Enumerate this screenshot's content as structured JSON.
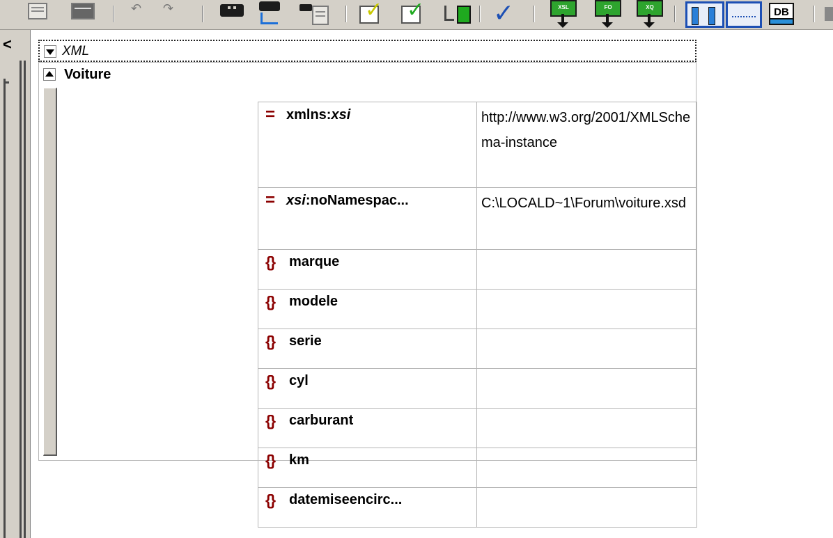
{
  "toolbar": {
    "icons": [
      "page-icon",
      "page-icon",
      "undo-icon",
      "redo-icon",
      "find-icon",
      "replace-icon",
      "find-in-files-icon",
      "check-wellformed-icon",
      "validate-icon",
      "validate-schema-icon",
      "spellcheck-icon",
      "xsl-transform-icon",
      "fo-transform-icon",
      "xq-transform-icon",
      "grid-view-icon",
      "text-view-icon",
      "db-icon"
    ],
    "xsl_label": "XSL",
    "fo_label": "FO",
    "xq_label": "XQ",
    "db_label": "DB"
  },
  "editor": {
    "xml_label": "XML",
    "root_element": "Voiture",
    "attributes": [
      {
        "prefix": "xmlns:",
        "name_italic": "xsi",
        "value": "http://www.w3.org/2001/XMLSchema-instance"
      },
      {
        "prefix_italic": "xsi",
        "name_rest": ":noNamespac...",
        "value": "C:\\LOCALD~1\\Forum\\voiture.xsd"
      }
    ],
    "elements": [
      {
        "name": "marque",
        "value": ""
      },
      {
        "name": "modele",
        "value": ""
      },
      {
        "name": "serie",
        "value": ""
      },
      {
        "name": "cyl",
        "value": ""
      },
      {
        "name": "carburant",
        "value": ""
      },
      {
        "name": "km",
        "value": ""
      },
      {
        "name": "datemiseencirc...",
        "value": ""
      }
    ]
  },
  "colors": {
    "icon_red": "#8b0000",
    "toolbar_bg": "#d4d0c8",
    "grid_border": "#b5b5b5",
    "view_blue": "#1c4fb4",
    "transform_green": "#2ea42e"
  }
}
